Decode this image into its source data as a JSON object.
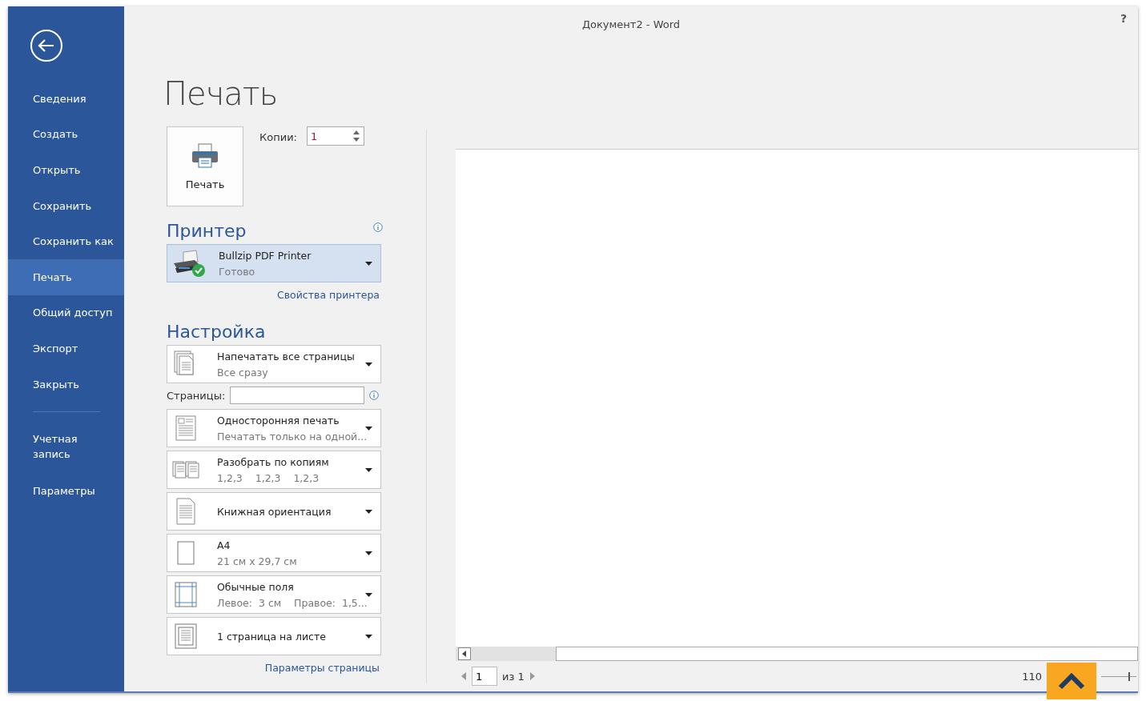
{
  "window": {
    "title": "Документ2 - Word",
    "help": "?"
  },
  "nav": {
    "items": [
      {
        "label": "Сведения",
        "selected": false
      },
      {
        "label": "Создать",
        "selected": false
      },
      {
        "label": "Открыть",
        "selected": false
      },
      {
        "label": "Сохранить",
        "selected": false
      },
      {
        "label": "Сохранить как",
        "selected": false
      },
      {
        "label": "Печать",
        "selected": true
      },
      {
        "label": "Общий доступ",
        "selected": false
      },
      {
        "label": "Экспорт",
        "selected": false
      },
      {
        "label": "Закрыть",
        "selected": false
      }
    ],
    "bottom_items": [
      {
        "label": "Учетная запись",
        "selected": false
      },
      {
        "label": "Параметры",
        "selected": false
      }
    ]
  },
  "page_title": "Печать",
  "print_button": "Печать",
  "copies": {
    "label": "Копии:",
    "value": "1"
  },
  "printer": {
    "heading": "Принтер",
    "name": "Bullzip PDF Printer",
    "status": "Готово",
    "properties_link": "Свойства принтера"
  },
  "settings": {
    "heading": "Настройка",
    "items": [
      {
        "kind": "dropdown",
        "title": "Напечатать все страницы",
        "subtitle": "Все сразу"
      },
      {
        "kind": "field",
        "label": "Страницы:"
      },
      {
        "kind": "dropdown",
        "title": "Односторонняя печать",
        "subtitle": "Печатать только на одной..."
      },
      {
        "kind": "dropdown",
        "title": "Разобрать по копиям",
        "subtitle": "1,2,3    1,2,3    1,2,3"
      },
      {
        "kind": "dropdown",
        "title": "Книжная ориентация"
      },
      {
        "kind": "dropdown",
        "title": "A4",
        "subtitle": "21 см x 29,7 см"
      },
      {
        "kind": "dropdown",
        "title": "Обычные поля",
        "subtitle": "Левое:  3 см    Правое:  1,5..."
      },
      {
        "kind": "dropdown",
        "title": "1 страница на листе"
      }
    ],
    "page_setup_link": "Параметры страницы"
  },
  "preview": {
    "page_field": "1",
    "page_total": "из 1",
    "zoom": "110",
    "zoom_slider": {
      "level": 0.8
    }
  }
}
